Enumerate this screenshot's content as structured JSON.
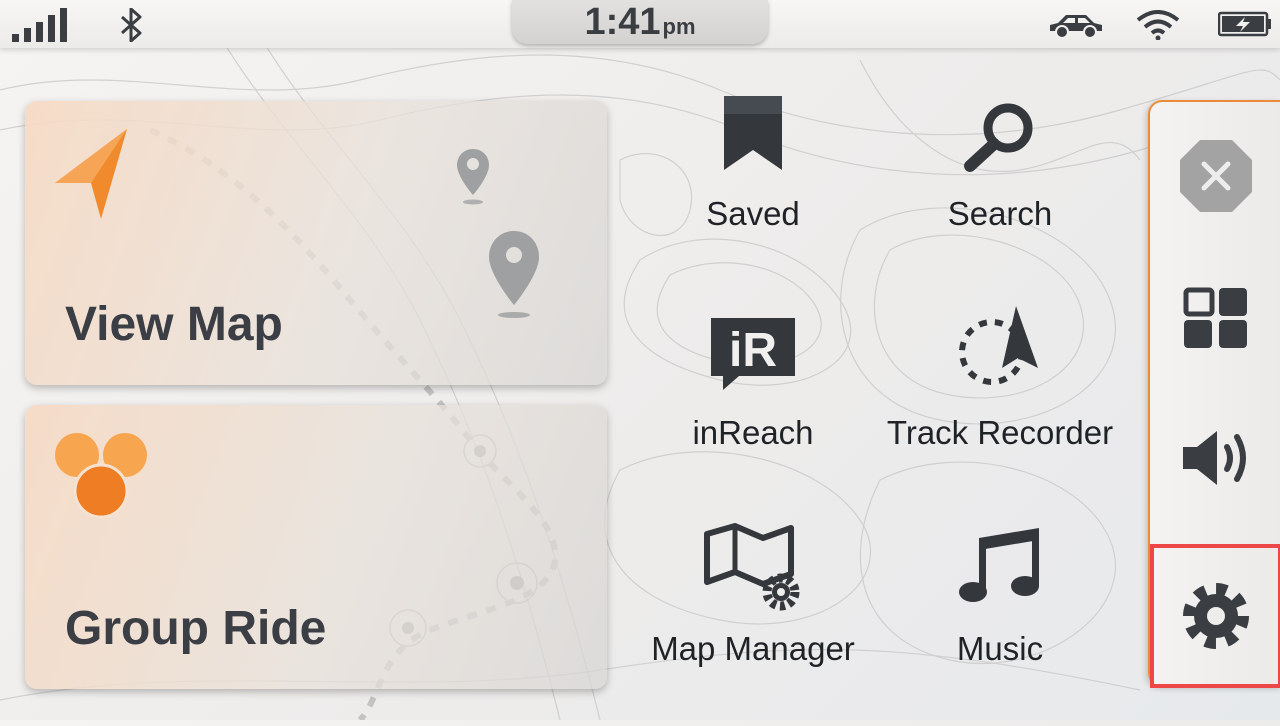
{
  "status_bar": {
    "time": "1:41",
    "ampm": "pm",
    "icons": [
      "signal-strength-icon",
      "bluetooth-icon",
      "vehicle-icon",
      "wifi-icon",
      "battery-charging-icon"
    ]
  },
  "tiles": [
    {
      "label": "View Map",
      "icon": "navigation-arrow-icon"
    },
    {
      "label": "Group Ride",
      "icon": "group-ride-icon"
    }
  ],
  "apps": [
    {
      "label": "Saved",
      "icon": "bookmark-icon"
    },
    {
      "label": "Search",
      "icon": "magnifier-icon"
    },
    {
      "label": "inReach",
      "icon": "inreach-icon",
      "icon_text": "iR"
    },
    {
      "label": "Track Recorder",
      "icon": "track-recorder-icon"
    },
    {
      "label": "Map Manager",
      "icon": "map-manager-icon"
    },
    {
      "label": "Music",
      "icon": "music-note-icon"
    }
  ],
  "rail": {
    "buttons": [
      "close-icon",
      "apps-grid-icon",
      "volume-icon",
      "settings-gear-icon"
    ],
    "selected": "settings-gear-icon"
  },
  "colors": {
    "accent": "#e98b3a",
    "icon_dark": "#3a3e43",
    "selection": "#ee4747"
  }
}
